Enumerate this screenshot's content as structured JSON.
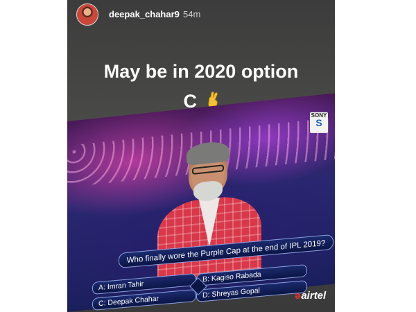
{
  "story": {
    "username": "deepak_chahar9",
    "time": "54m",
    "caption_line1": "May be in 2020 option",
    "caption_line2": "C"
  },
  "tv": {
    "channel_logo": "SONY",
    "channel_letter": "S",
    "question": "Who finally wore the Purple Cap at the end of IPL 2019?",
    "options": {
      "a": "A: Imran Tahir",
      "b": "B: Kagiso Rabada",
      "c": "C: Deepak Chahar",
      "d": "D: Shreyas Gopal"
    },
    "sponsor": "airtel"
  },
  "icons": {
    "caption_emoji": "crossed-fingers-icon",
    "sponsor_mark": "airtel-logo-icon"
  },
  "colors": {
    "story_background": "#3c3c3c",
    "quiz_panel": "#0b1545",
    "jacket_red": "#d8384a"
  }
}
